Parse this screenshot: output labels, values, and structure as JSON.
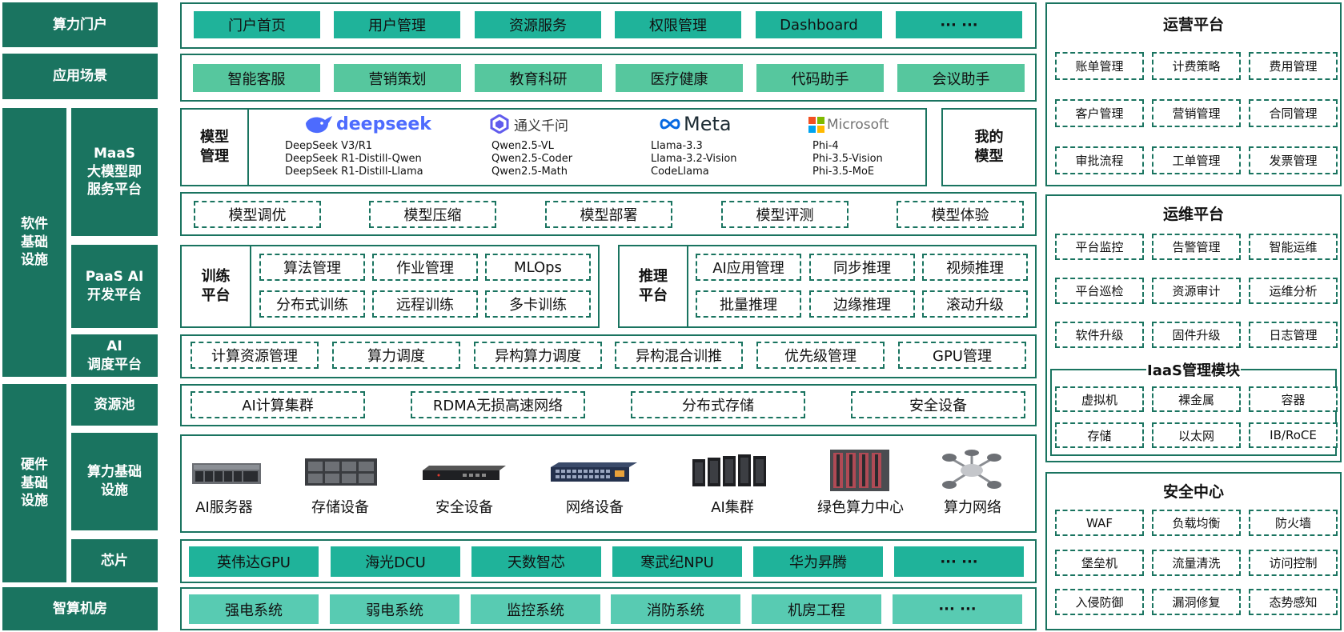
{
  "left_labels": {
    "portal": "算力门户",
    "scenario": "应用场景",
    "software": [
      "软件",
      "基础",
      "设施"
    ],
    "maas": [
      "MaaS",
      "大模型即",
      "服务平台"
    ],
    "paas": [
      "PaaS AI",
      "开发平台"
    ],
    "ai_sched": [
      "AI",
      "调度平台"
    ],
    "hardware": [
      "硬件",
      "基础",
      "设施"
    ],
    "resource_pool": "资源池",
    "compute_infra": [
      "算力基础",
      "设施"
    ],
    "chip": "芯片",
    "datacenter": "智算机房"
  },
  "portal_items": [
    "门户首页",
    "用户管理",
    "资源服务",
    "权限管理",
    "Dashboard",
    "··· ···"
  ],
  "scenario_items": [
    "智能客服",
    "营销策划",
    "教育科研",
    "医疗健康",
    "代码助手",
    "会议助手"
  ],
  "model_mgmt": {
    "label": [
      "模型",
      "管理"
    ],
    "my_models": [
      "我的",
      "模型"
    ],
    "vendors": [
      {
        "logo": "deepseek",
        "models": [
          "DeepSeek V3/R1",
          "DeepSeek R1-Distill-Qwen",
          "DeepSeek R1-Distill-Llama"
        ]
      },
      {
        "logo": "通义千问",
        "models": [
          "Qwen2.5-VL",
          "Qwen2.5-Coder",
          "Qwen2.5-Math"
        ]
      },
      {
        "logo": "Meta",
        "models": [
          "Llama-3.3",
          "Llama-3.2-Vision",
          "CodeLlama"
        ]
      },
      {
        "logo": "Microsoft",
        "models": [
          "Phi-4",
          "Phi-3.5-Vision",
          "Phi-3.5-MoE"
        ]
      }
    ]
  },
  "model_ops": [
    "模型调优",
    "模型压缩",
    "模型部署",
    "模型评测",
    "模型体验"
  ],
  "training": {
    "label": [
      "训练",
      "平台"
    ],
    "items": [
      "算法管理",
      "作业管理",
      "MLOps",
      "分布式训练",
      "远程训练",
      "多卡训练"
    ]
  },
  "inference": {
    "label": [
      "推理",
      "平台"
    ],
    "items": [
      "AI应用管理",
      "同步推理",
      "视频推理",
      "批量推理",
      "边缘推理",
      "滚动升级"
    ]
  },
  "sched_items": [
    "计算资源管理",
    "算力调度",
    "异构算力调度",
    "异构混合训推",
    "优先级管理",
    "GPU管理"
  ],
  "pool_items": [
    "AI计算集群",
    "RDMA无损高速网络",
    "分布式存储",
    "安全设备"
  ],
  "hardware_items": [
    "AI服务器",
    "存储设备",
    "安全设备",
    "网络设备",
    "AI集群",
    "绿色算力中心",
    "算力网络"
  ],
  "chip_items": [
    "英伟达GPU",
    "海光DCU",
    "天数智芯",
    "寒武纪NPU",
    "华为昇腾",
    "··· ···"
  ],
  "datacenter_items": [
    "强电系统",
    "弱电系统",
    "监控系统",
    "消防系统",
    "机房工程",
    "··· ···"
  ],
  "ops_platform": {
    "title": "运营平台",
    "items": [
      "账单管理",
      "计费策略",
      "费用管理",
      "客户管理",
      "营销管理",
      "合同管理",
      "审批流程",
      "工单管理",
      "发票管理"
    ]
  },
  "maint_platform": {
    "title": "运维平台",
    "items": [
      "平台监控",
      "告警管理",
      "智能运维",
      "平台巡检",
      "资源审计",
      "运维分析",
      "软件升级",
      "固件升级",
      "日志管理"
    ]
  },
  "iaas": {
    "title": "IaaS管理模块",
    "items": [
      "虚拟机",
      "裸金属",
      "容器",
      "存储",
      "以太网",
      "IB/RoCE"
    ]
  },
  "security": {
    "title": "安全中心",
    "items": [
      "WAF",
      "负载均衡",
      "防火墙",
      "堡垒机",
      "流量清洗",
      "访问控制",
      "入侵防御",
      "漏洞修复",
      "态势感知"
    ]
  },
  "colors": {
    "dark_green": "#1a7460",
    "teal": "#1fb39a",
    "green": "#56c79e",
    "mint": "#58cbb2"
  }
}
